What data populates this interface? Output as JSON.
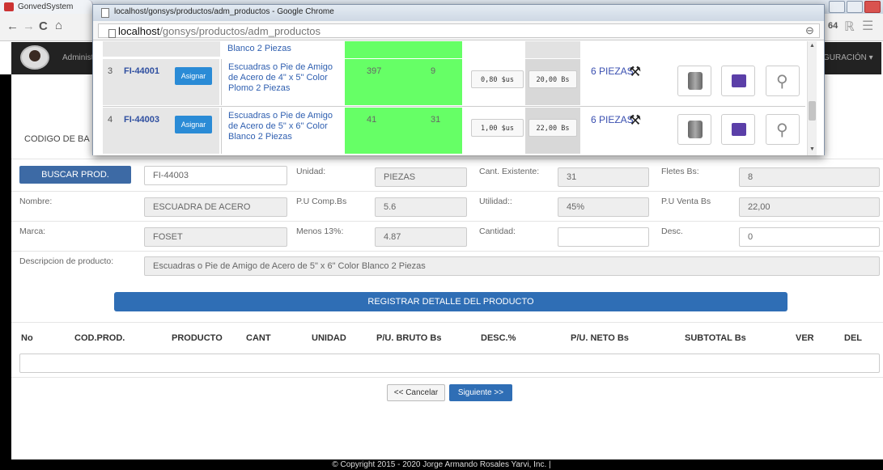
{
  "background": {
    "tab_title": "GonvedSystem",
    "admin_label": "Administ",
    "config_label": "GURACIÓN",
    "right_toolbar_text": "64"
  },
  "popup": {
    "window_title": "localhost/gonsys/productos/adm_productos - Google Chrome",
    "url_host": "localhost",
    "url_path": "/gonsys/productos/adm_productos",
    "rows": [
      {
        "num": "3",
        "code": "FI-44001",
        "assign": "Asignar",
        "name_lines": [
          "Escuadras o Pie de Amigo",
          "de Acero de 4\" x 5\" Color",
          "Plomo 2 Piezas"
        ],
        "stock1": "397",
        "stock2": "9",
        "price_usd": "0,80 $us",
        "price_bs": "20,00 Bs",
        "unit": "6 PIEZAS"
      },
      {
        "num": "4",
        "code": "FI-44003",
        "assign": "Asignar",
        "name_lines": [
          "Escuadras o Pie de Amigo",
          "de Acero de 5\" x 6\" Color",
          "Blanco 2 Piezas"
        ],
        "stock1": "41",
        "stock2": "31",
        "price_usd": "1,00 $us",
        "price_bs": "22,00 Bs",
        "unit": "6 PIEZAS"
      }
    ],
    "prev_row_tail": "Blanco 2 Piezas"
  },
  "form": {
    "codigo_label": "CODIGO DE BA",
    "buscar_label": "BUSCAR PROD.",
    "code_value": "FI-44003",
    "unidad_label": "Unidad:",
    "unidad_value": "PIEZAS",
    "cant_label": "Cant. Existente:",
    "cant_value": "31",
    "fletes_label": "Fletes Bs:",
    "fletes_value": "8",
    "nombre_label": "Nombre:",
    "nombre_value": "ESCUADRA DE ACERO",
    "pucomp_label": "P.U Comp.Bs",
    "pucomp_value": "5.6",
    "utilidad_label": "Utilidad::",
    "utilidad_value": "45%",
    "puventa_label": "P.U Venta Bs",
    "puventa_value": "22,00",
    "marca_label": "Marca:",
    "marca_value": "FOSET",
    "menos_label": "Menos 13%:",
    "menos_value": "4.87",
    "cantidad_label": "Cantidad:",
    "cantidad_value": "",
    "desc_label": "Desc.",
    "desc_value": "0",
    "descripcion_label": "Descripcion de producto:",
    "descripcion_value": "Escuadras o Pie de Amigo de Acero de 5\" x 6\" Color Blanco  2  Piezas",
    "registrar_label": "REGISTRAR DETALLE DEL PRODUCTO"
  },
  "table_headers": [
    "No",
    "COD.PROD.",
    "PRODUCTO",
    "CANT",
    "UNIDAD",
    "P/U. BRUTO Bs",
    "DESC.%",
    "P/U. NETO Bs",
    "SUBTOTAL Bs",
    "VER",
    "DEL"
  ],
  "buttons": {
    "cancel": "<< Cancelar",
    "next": "Siguiente >>"
  },
  "footer": "© Copyright 2015 - 2020 Jorge Armando Rosales Yarvi, Inc. |"
}
